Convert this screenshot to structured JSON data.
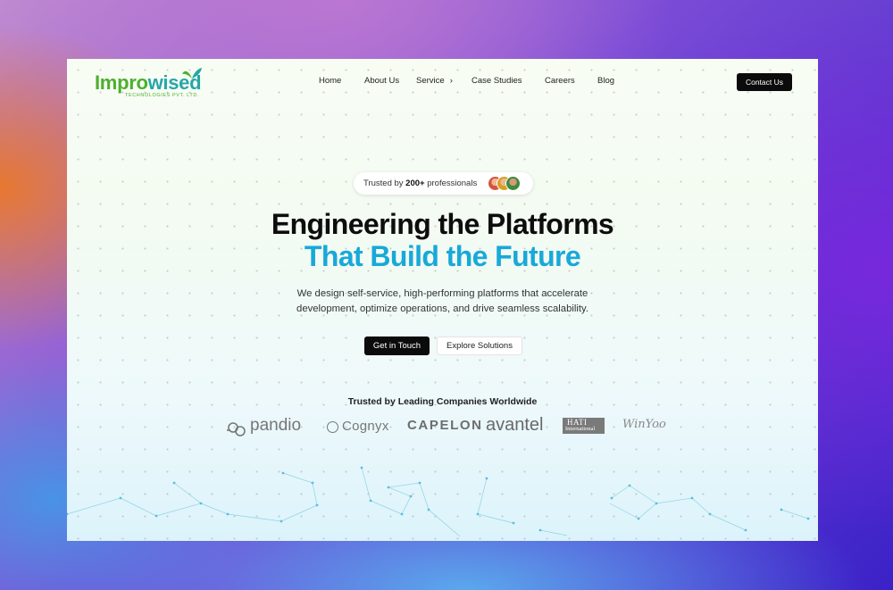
{
  "nav": {
    "logo_main_a": "Impro",
    "logo_main_b": "wised",
    "logo_sub": "TECHNOLOGIES PVT. LTD.",
    "items": [
      {
        "label": "Home"
      },
      {
        "label": "About Us"
      },
      {
        "label": "Service"
      },
      {
        "label": "Case Studies"
      },
      {
        "label": "Careers"
      },
      {
        "label": "Blog"
      }
    ],
    "service_arrow": "›",
    "contact_label": "Contact Us"
  },
  "hero": {
    "pill_prefix": "Trusted by ",
    "pill_count": "200+",
    "pill_suffix": " professionals",
    "title_line1": "Engineering the Platforms",
    "title_line2": "That Build the Future",
    "desc_line1": "We design self-service, high-performing platforms that accelerate",
    "desc_line2": "development, optimize operations, and drive seamless scalability.",
    "cta_primary": "Get in Touch",
    "cta_secondary": "Explore Solutions"
  },
  "clients": {
    "heading": "Trusted by Leading Companies Worldwide",
    "logos": [
      {
        "name": "pandio"
      },
      {
        "name": "Cognyx"
      },
      {
        "name": "CAPELON"
      },
      {
        "name": "avantel"
      },
      {
        "name": "HATI",
        "sub": "International"
      },
      {
        "name": "WinYoo"
      }
    ]
  },
  "colors": {
    "brand_green": "#4caf2f",
    "brand_teal": "#27a6a8",
    "accent_blue": "#18a9d8",
    "button_dark": "#0b0b0b"
  }
}
